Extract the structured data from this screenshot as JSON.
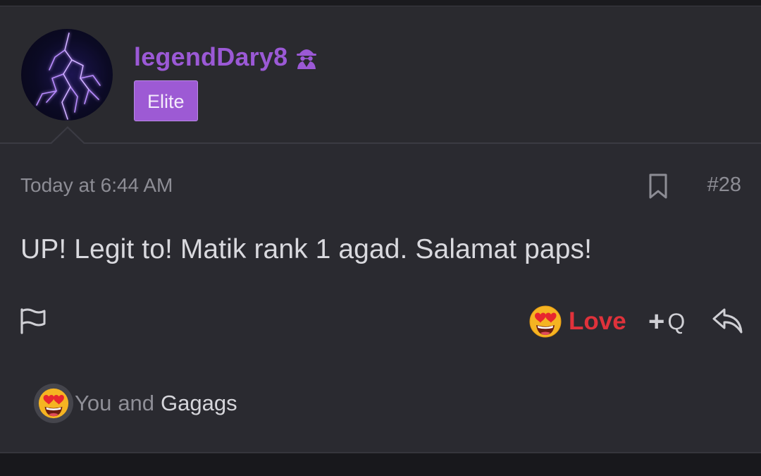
{
  "post": {
    "author": {
      "username": "legendDary8",
      "user_title_badge": "Elite",
      "avatar_icon": "lightning-avatar",
      "status_icon": "spy-icon"
    },
    "timestamp": "Today at 6:44 AM",
    "post_number": "#28",
    "message": "UP! Legit to! Matik rank 1 agad. Salamat paps!",
    "actions": {
      "report_icon": "flag-icon",
      "bookmark_icon": "bookmark-icon",
      "reaction_label": "Love",
      "reaction_icon": "heart-eyes-emoji",
      "multiquote_plus": "+",
      "multiquote_label": "Q",
      "reply_icon": "reply-arrow-icon"
    },
    "reactions": {
      "you": "You",
      "and": "and",
      "user": "Gagags"
    }
  },
  "colors": {
    "username": "#9b59d6",
    "badge": "#9d5ad4",
    "love": "#e0323b",
    "background": "#2a2a30"
  }
}
